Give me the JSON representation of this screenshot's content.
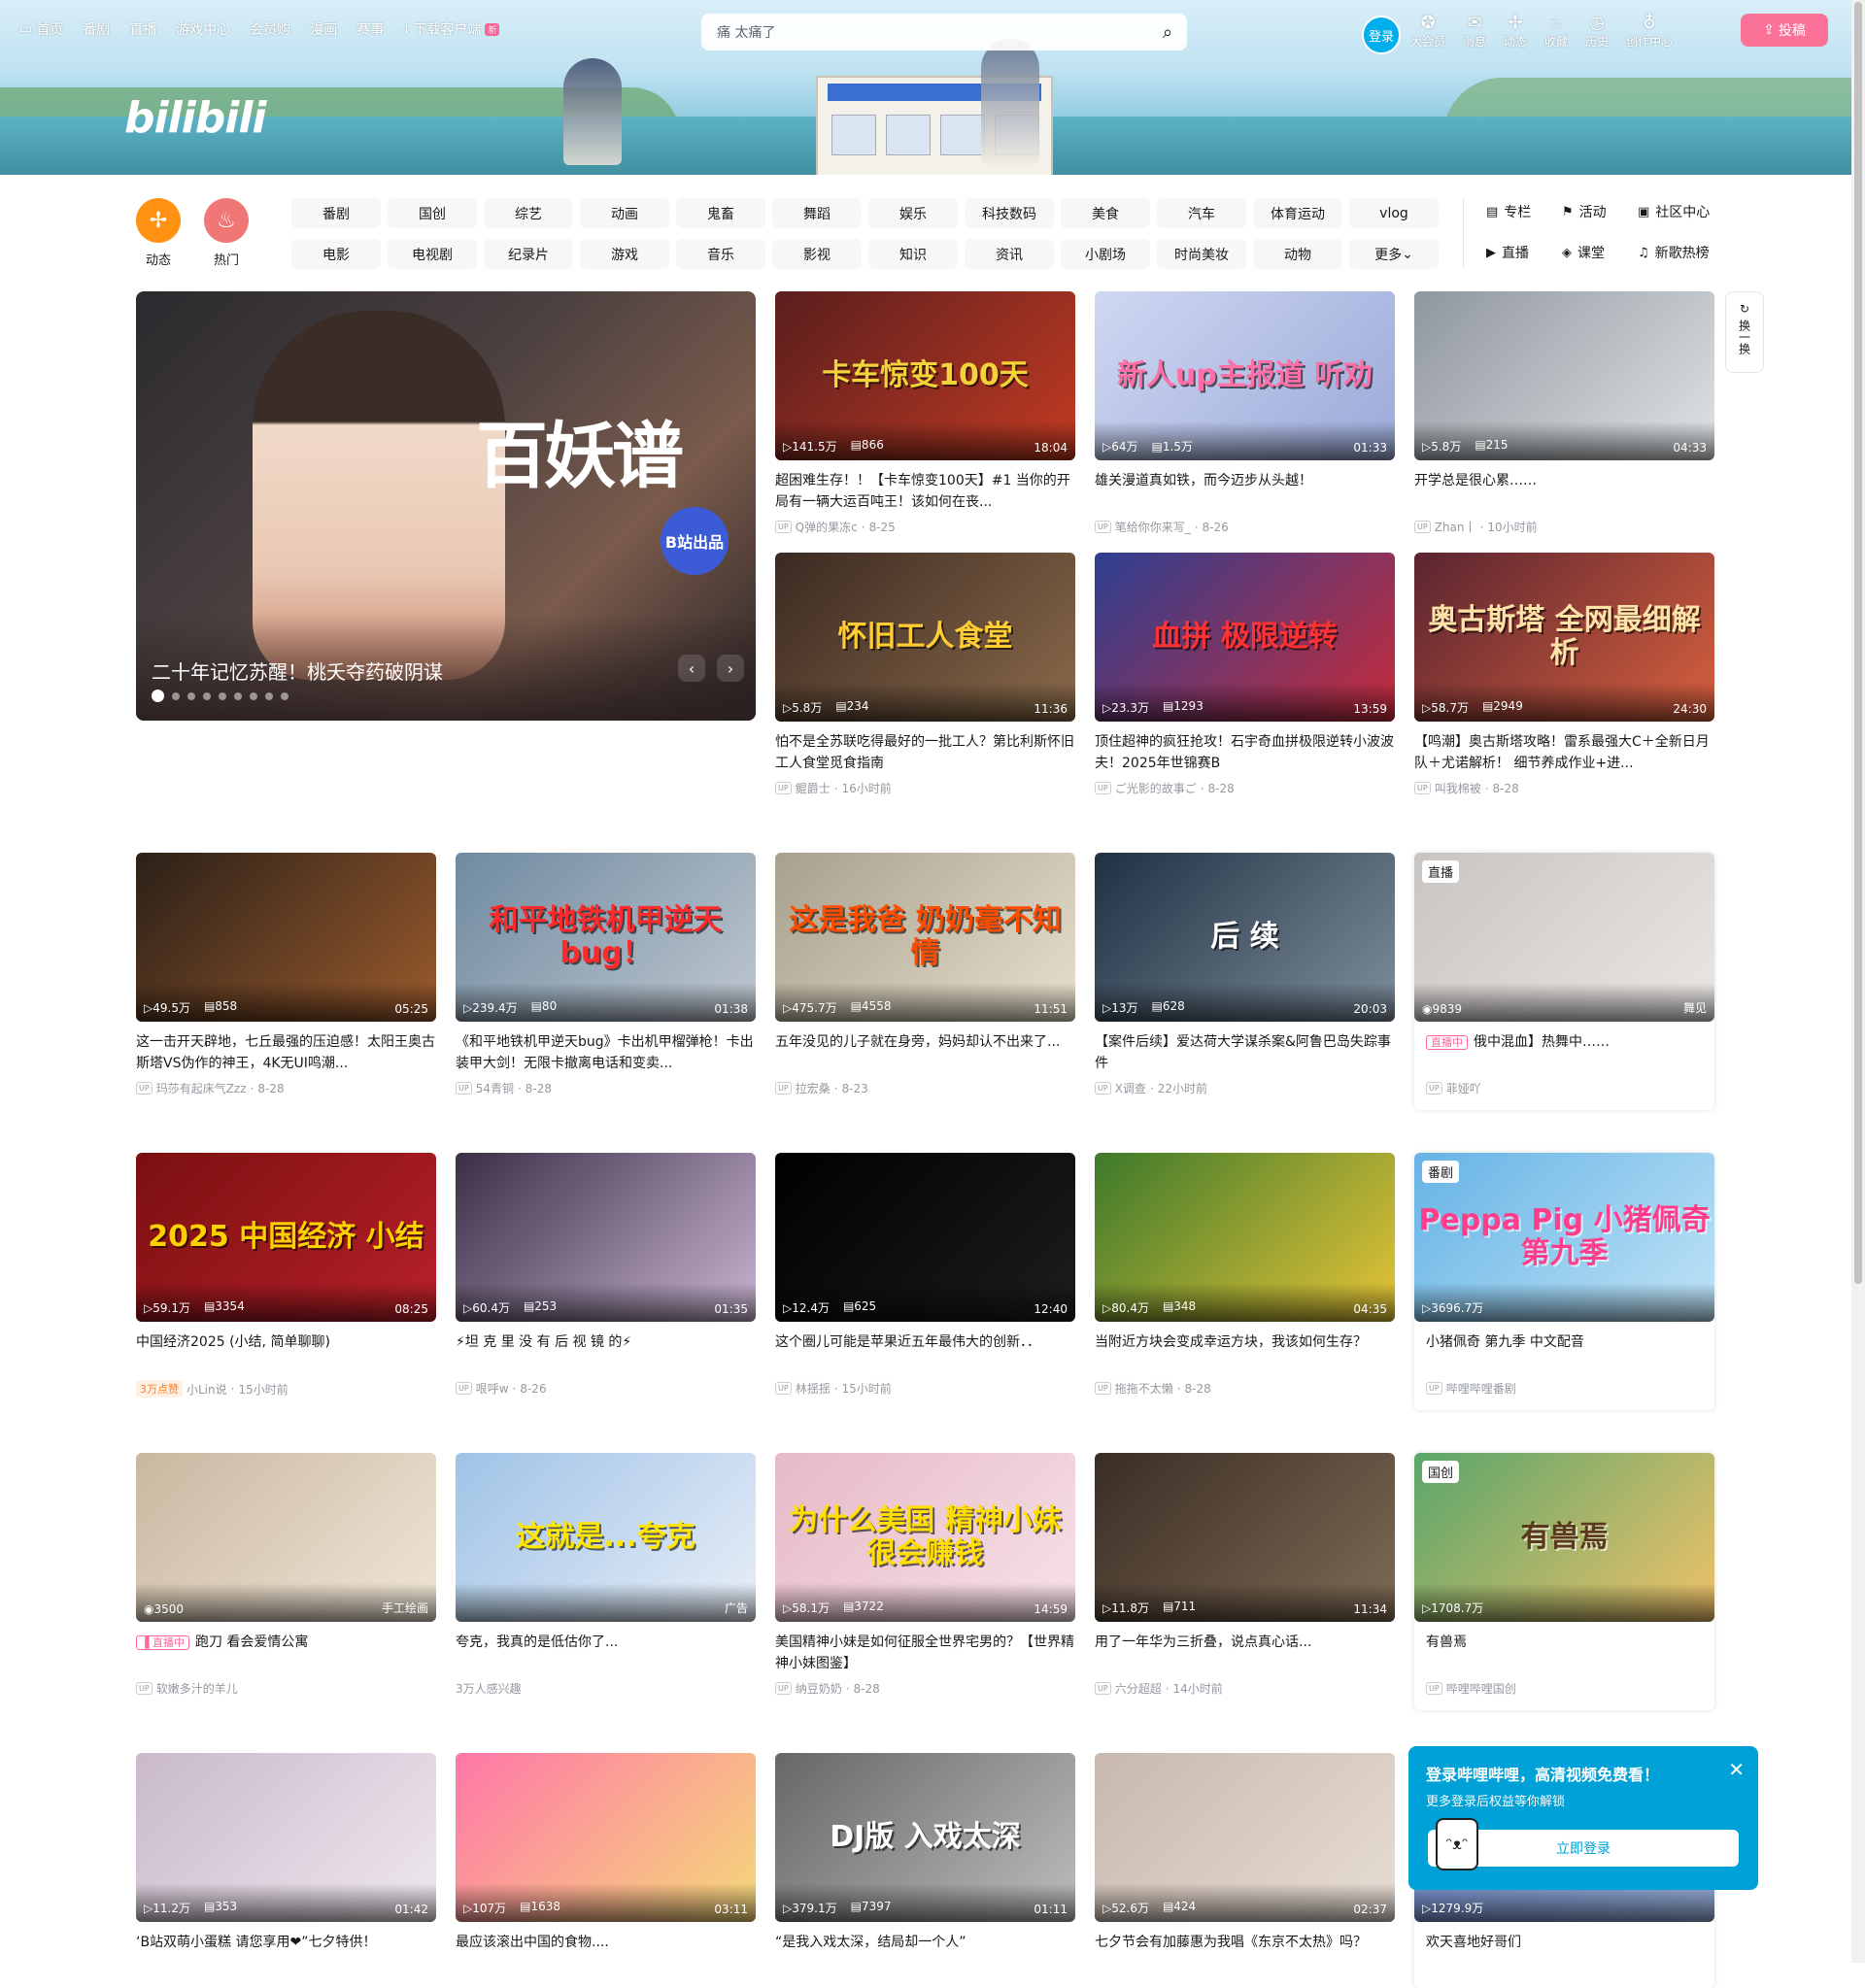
{
  "topnav": {
    "items": [
      "首页",
      "番剧",
      "直播",
      "游戏中心",
      "会员购",
      "漫画",
      "赛事"
    ],
    "download": "下载客户端",
    "new_badge": "新"
  },
  "logo": "bilibili",
  "search": {
    "value": "痛 太痛了"
  },
  "header_right": {
    "login": "登录",
    "items": [
      "大会员",
      "消息",
      "动态",
      "收藏",
      "历史",
      "创作中心"
    ],
    "upload": "投稿"
  },
  "channels": {
    "dynamic": "动态",
    "hot": "热门",
    "tags": [
      "番剧",
      "国创",
      "综艺",
      "动画",
      "鬼畜",
      "舞蹈",
      "娱乐",
      "科技数码",
      "美食",
      "汽车",
      "体育运动",
      "vlog",
      "电影",
      "电视剧",
      "纪录片",
      "游戏",
      "音乐",
      "影视",
      "知识",
      "资讯",
      "小剧场",
      "时尚美妆",
      "动物",
      "更多"
    ],
    "links": [
      "专栏",
      "活动",
      "社区中心",
      "直播",
      "课堂",
      "新歌热榜"
    ]
  },
  "carousel": {
    "title_art": "百妖谱",
    "badge": "B站出品",
    "caption": "二十年记忆苏醒！桃夭夺药破阴谋"
  },
  "refresh": "换一换",
  "cards": [
    {
      "thumb": "卡车惊变100天",
      "views": "141.5万",
      "danmaku": "866",
      "dur": "18:04",
      "title": "超困难生存！！【卡车惊变100天】#1 当你的开局有一辆大运百吨王！该如何在丧...",
      "up": "Q弹的果冻c",
      "date": "8-25"
    },
    {
      "thumb": "新人up主报道 听劝",
      "views": "64万",
      "danmaku": "1.5万",
      "dur": "01:33",
      "title": "雄关漫道真如铁，而今迈步从头越！",
      "up": "笔给你你来写_",
      "date": "8-26"
    },
    {
      "thumb": "",
      "views": "5.8万",
      "danmaku": "215",
      "dur": "04:33",
      "title": "开学总是很心累……",
      "up": "Zhan丨",
      "date": "10小时前"
    },
    {
      "thumb": "怀旧工人食堂",
      "views": "5.8万",
      "danmaku": "234",
      "dur": "11:36",
      "title": "怕不是全苏联吃得最好的一批工人？第比利斯怀旧工人食堂觅食指南",
      "up": "鲲爵士",
      "date": "16小时前"
    },
    {
      "thumb": "血拼 极限逆转",
      "views": "23.3万",
      "danmaku": "1293",
      "dur": "13:59",
      "title": "顶住超神的疯狂抢攻！石宇奇血拼极限逆转小波波夫！2025年世锦赛B",
      "up": "ご光影的故事ご",
      "date": "8-28"
    },
    {
      "thumb": "奥古斯塔 全网最细解析",
      "views": "58.7万",
      "danmaku": "2949",
      "dur": "24:30",
      "title": "【鸣潮】奥古斯塔攻略！雷系最强大C＋全新日月队＋尤诺解析！ 细节养成作业+进...",
      "up": "叫我棉被",
      "date": "8-28"
    },
    {
      "thumb": "",
      "views": "49.5万",
      "danmaku": "858",
      "dur": "05:25",
      "title": "这一击开天辟地，七丘最强的压迫感！太阳王奥古斯塔VS伪作的神王，4K无UI鸣潮...",
      "up": "玛莎有起床气Zzz",
      "date": "8-28"
    },
    {
      "thumb": "和平地铁机甲逆天bug！",
      "views": "239.4万",
      "danmaku": "80",
      "dur": "01:38",
      "title": "《和平地铁机甲逆天bug》卡出机甲榴弹枪！卡出装甲大剑！无限卡撤离电话和变卖...",
      "up": "54青铜",
      "date": "8-28"
    },
    {
      "thumb": "这是我爸 奶奶毫不知情",
      "views": "475.7万",
      "danmaku": "4558",
      "dur": "11:51",
      "title": "五年没见的儿子就在身旁，妈妈却认不出来了...",
      "up": "拉宏桑",
      "date": "8-23"
    },
    {
      "thumb": "后 续",
      "views": "13万",
      "danmaku": "628",
      "dur": "20:03",
      "title": "【案件后续】爱达荷大学谋杀案&阿鲁巴岛失踪事件",
      "up": "X调查",
      "date": "22小时前"
    },
    {
      "thumb": "2025 中国经济 小结",
      "views": "59.1万",
      "danmaku": "3354",
      "dur": "08:25",
      "title": "中国经济2025 (小结, 简单聊聊)",
      "up": "小Lin说",
      "date": "15小时前",
      "likes": "3万点赞"
    },
    {
      "thumb": "",
      "views": "60.4万",
      "danmaku": "253",
      "dur": "01:35",
      "title": "⚡坦 克 里 没 有 后 视 镜 的⚡",
      "up": "哏呼w",
      "date": "8-26"
    },
    {
      "thumb": "",
      "views": "12.4万",
      "danmaku": "625",
      "dur": "12:40",
      "title": "这个圈儿可能是苹果近五年最伟大的创新．．",
      "up": "林揺揺",
      "date": "15小时前"
    },
    {
      "thumb": "",
      "views": "80.4万",
      "danmaku": "348",
      "dur": "04:35",
      "title": "当附近方块会变成幸运方块，我该如何生存？",
      "up": "拖拖不太懒",
      "date": "8-28"
    },
    {
      "thumb": "",
      "views": "3500",
      "danmaku": "",
      "dur": "手工绘画",
      "title": "跑刀 看会爱情公寓",
      "up": "软嫩多汁的羊儿",
      "date": ""
    },
    {
      "thumb": "这就是...夸克",
      "views": "",
      "danmaku": "",
      "dur": "广告",
      "title": "夸克，我真的是低估你了...",
      "up": "",
      "date": "3万人感兴趣"
    },
    {
      "thumb": "为什么美国 精神小妹 很会赚钱",
      "views": "58.1万",
      "danmaku": "3722",
      "dur": "14:59",
      "title": "美国精神小妹是如何征服全世界宅男的？【世界精神小妹图鉴】",
      "up": "纳豆奶奶",
      "date": "8-28"
    },
    {
      "thumb": "",
      "views": "11.8万",
      "danmaku": "711",
      "dur": "11:34",
      "title": "用了一年华为三折叠，说点真心话...",
      "up": "六分超超",
      "date": "14小时前"
    },
    {
      "thumb": "",
      "views": "11.2万",
      "danmaku": "353",
      "dur": "01:42",
      "title": "‘B站双萌小蛋糕 请您享用❤”七夕特供！",
      "up": "",
      "date": ""
    },
    {
      "thumb": "",
      "views": "107万",
      "danmaku": "1638",
      "dur": "03:11",
      "title": "最应该滚出中国的食物....",
      "up": "",
      "date": ""
    },
    {
      "thumb": "DJ版 入戏太深",
      "views": "379.1万",
      "danmaku": "7397",
      "dur": "01:11",
      "title": "“是我入戏太深，结局却一个人”",
      "up": "",
      "date": ""
    },
    {
      "thumb": "",
      "views": "52.6万",
      "danmaku": "424",
      "dur": "02:37",
      "title": "七夕节会有加藤惠为我唱《东京不太热》吗？",
      "up": "",
      "date": ""
    }
  ],
  "side_cards": [
    {
      "chip": "直播",
      "views": "9839",
      "dur": "舞见",
      "live": "直播中",
      "title": "俄中混血】热舞中……",
      "up": "菲娅吖"
    },
    {
      "chip": "番剧",
      "views": "3696.7万",
      "thumb": "Peppa Pig 小猪佩奇 第九季",
      "title": "小猪佩奇 第九季 中文配音",
      "up": "哔哩哔哩番剧"
    },
    {
      "chip": "国创",
      "views": "1708.7万",
      "thumb": "有兽焉",
      "title": "有兽焉",
      "up": "哔哩哔哩国创"
    },
    {
      "views": "1279.9万",
      "title": "欢天喜地好哥们"
    }
  ],
  "popup": {
    "heading": "登录哔哩哔哩，高清视频免费看！",
    "sub": "更多登录后权益等你解锁",
    "button": "立即登录"
  }
}
